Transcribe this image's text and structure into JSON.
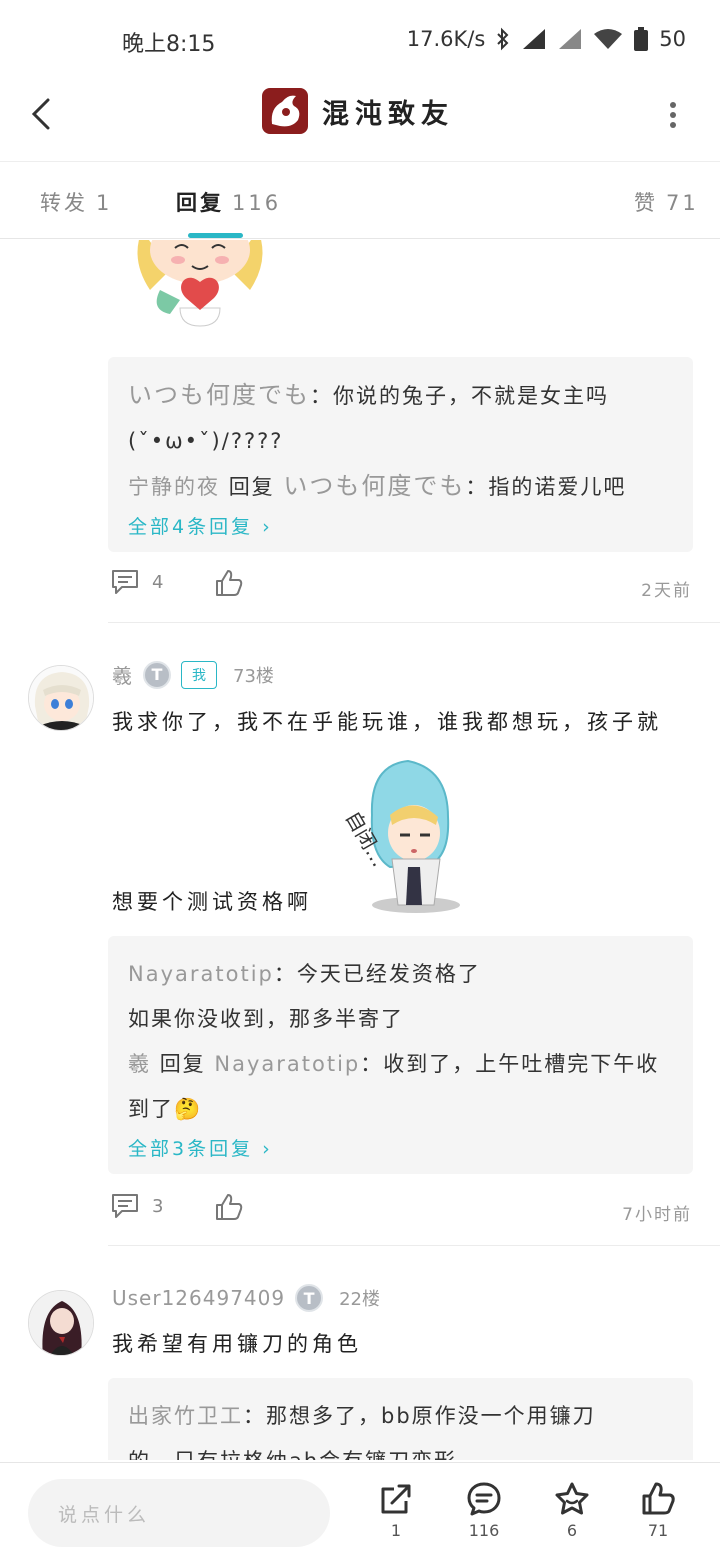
{
  "status": {
    "time": "晚上8:15",
    "speed": "17.6K/s",
    "battery": "50"
  },
  "header": {
    "title": "混沌致友"
  },
  "tabs": {
    "forward_label": "转发",
    "forward_count": "1",
    "reply_label": "回复",
    "reply_count": "116",
    "like_label": "赞",
    "like_count": "71"
  },
  "posts": [
    {
      "replies": [
        {
          "name": "いつも何度でも",
          "text": "：你说的兔子，不就是女主吗"
        },
        {
          "text": "(ˇ•ω•ˇ)/????"
        },
        {
          "name": "宁静的夜",
          "reply_word": "回复",
          "target": "いつも何度でも",
          "text": "：指的诺爱儿吧"
        }
      ],
      "more": "全部4条回复",
      "comment_count": "4",
      "time": "2天前"
    },
    {
      "user": "羲",
      "me_badge": "我",
      "floor": "73楼",
      "text_line1": "我求你了，我不在乎能玩谁，谁我都想玩，孩子就",
      "text_line2": "想要个测试资格啊",
      "sticker_text": "自闭…",
      "replies": [
        {
          "name": "Nayaratotip",
          "text": "：今天已经发资格了"
        },
        {
          "text": "如果你没收到，那多半寄了"
        },
        {
          "name": "羲",
          "reply_word": "回复",
          "target": "Nayaratotip",
          "text": "：收到了，上午吐槽完下午收"
        },
        {
          "text": "到了🤔"
        }
      ],
      "more": "全部3条回复",
      "comment_count": "3",
      "time": "7小时前"
    },
    {
      "user": "User126497409",
      "floor": "22楼",
      "text_line1": "我希望有用镰刀的角色",
      "replies": [
        {
          "name": "出家竹卫工",
          "text": "：那想多了，bb原作没一个用镰刀"
        },
        {
          "text": "的，只有拉格纳ah会有镰刀变形"
        }
      ]
    }
  ],
  "bottom": {
    "placeholder": "说点什么",
    "share_count": "1",
    "comment_count": "116",
    "star_count": "6",
    "like_count": "71"
  },
  "colors": {
    "accent": "#2ab7c6",
    "reply_bg": "#f5f5f5"
  }
}
